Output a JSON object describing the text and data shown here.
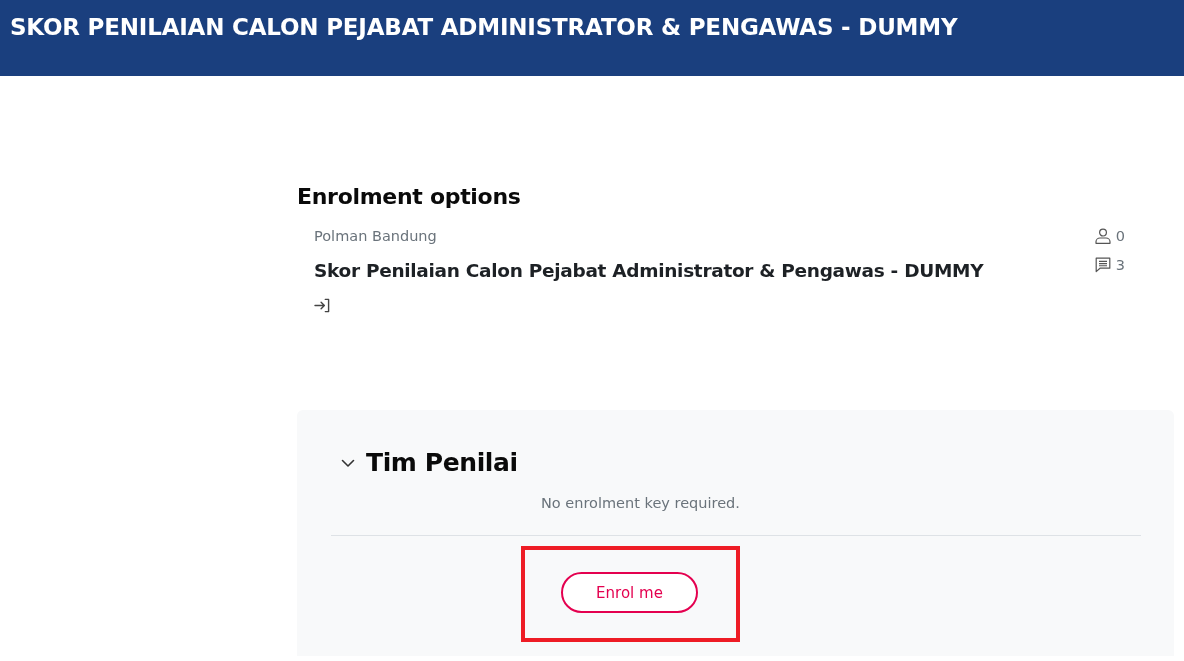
{
  "header": {
    "title": "SKOR PENILAIAN CALON PEJABAT ADMINISTRATOR & PENGAWAS - DUMMY"
  },
  "enrolment": {
    "heading": "Enrolment options",
    "course": {
      "category": "Polman Bandung",
      "name": "Skor Penilaian Calon Pejabat Administrator & Pengawas - DUMMY",
      "participants": "0",
      "comments": "3"
    }
  },
  "method": {
    "title": "Tim Penilai",
    "expanded": true,
    "message": "No enrolment key required.",
    "button": {
      "label": "Enrol me",
      "highlighted": true
    }
  }
}
